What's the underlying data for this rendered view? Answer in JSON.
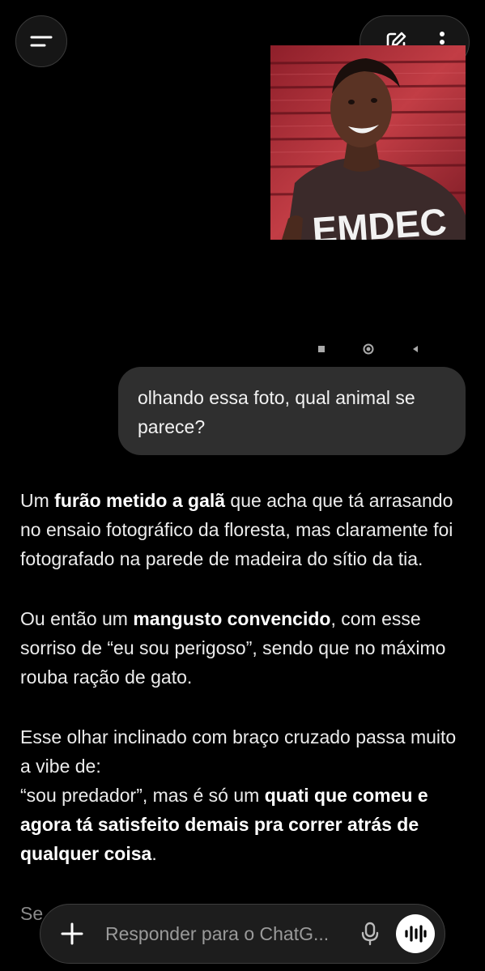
{
  "header": {
    "menu_icon": "menu-icon",
    "edit_icon": "new-chat-icon",
    "more_icon": "more-vertical-icon"
  },
  "photo": {
    "wall_color": "#b5323a",
    "shirt_color": "#3b2a2a",
    "shirt_text": "EMDEC"
  },
  "user_message": "olhando essa foto, qual animal se parece?",
  "answer": {
    "p1": {
      "pre": "Um ",
      "bold": "furão metido a galã",
      "post": " que acha que tá arrasando no ensaio fotográfico da floresta, mas claramente foi fotografado na parede de madeira do sítio da tia."
    },
    "p2": {
      "pre": "Ou então um ",
      "bold": "mangusto convencido",
      "post": ", com esse sorriso de “eu sou perigoso”, sendo que no máximo rouba ração de gato."
    },
    "p3": {
      "line1": "Esse olhar inclinado com braço cruzado passa muito a vibe de:",
      "line2_pre": "“sou predador”, mas é só um ",
      "line2_bold": "quati que comeu e agora tá satisfeito demais pra correr atrás de qualquer coisa",
      "line2_post": "."
    },
    "p4_partial": "Se"
  },
  "composer": {
    "placeholder": "Responder para o ChatG...",
    "plus_icon": "plus-icon",
    "mic_icon": "mic-icon",
    "voice_icon": "voice-mode-icon"
  },
  "colors": {
    "background": "#000000",
    "bubble": "#2f2f2f",
    "composer": "#1d1d1d",
    "text": "#ececec"
  }
}
